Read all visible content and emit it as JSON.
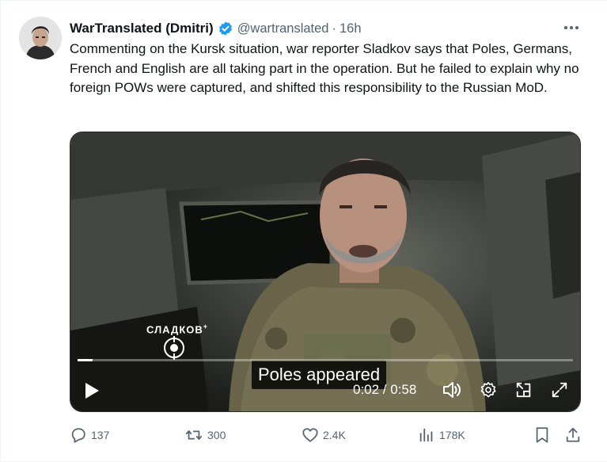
{
  "author": {
    "display_name": "WarTranslated (Dmitri)",
    "handle": "@wartranslated",
    "separator": "·",
    "time": "16h",
    "verified": true,
    "verified_color": "#1d9bf0"
  },
  "tweet": {
    "text": "Commenting on the Kursk situation, war reporter Sladkov says that Poles, Germans, French and English are all taking part in the operation. But he failed to explain why no foreign POWs were captured, and shifted this responsibility to the Russian MoD."
  },
  "video": {
    "caption": "Poles appeared",
    "timecode": "0:02 / 0:58",
    "progress_fraction": 0.03,
    "watermark": "СЛАДКОВ",
    "watermark_plus": "+",
    "controls": {
      "play_icon": "play-icon",
      "volume_icon": "volume-icon",
      "settings_icon": "settings-gear-icon",
      "popout_icon": "popout-icon",
      "fullscreen_icon": "fullscreen-icon"
    }
  },
  "actions": {
    "replies": "137",
    "reposts": "300",
    "likes": "2.4K",
    "views": "178K"
  },
  "colors": {
    "text_primary": "#0f1419",
    "text_secondary": "#536471",
    "accent": "#1d9bf0"
  }
}
